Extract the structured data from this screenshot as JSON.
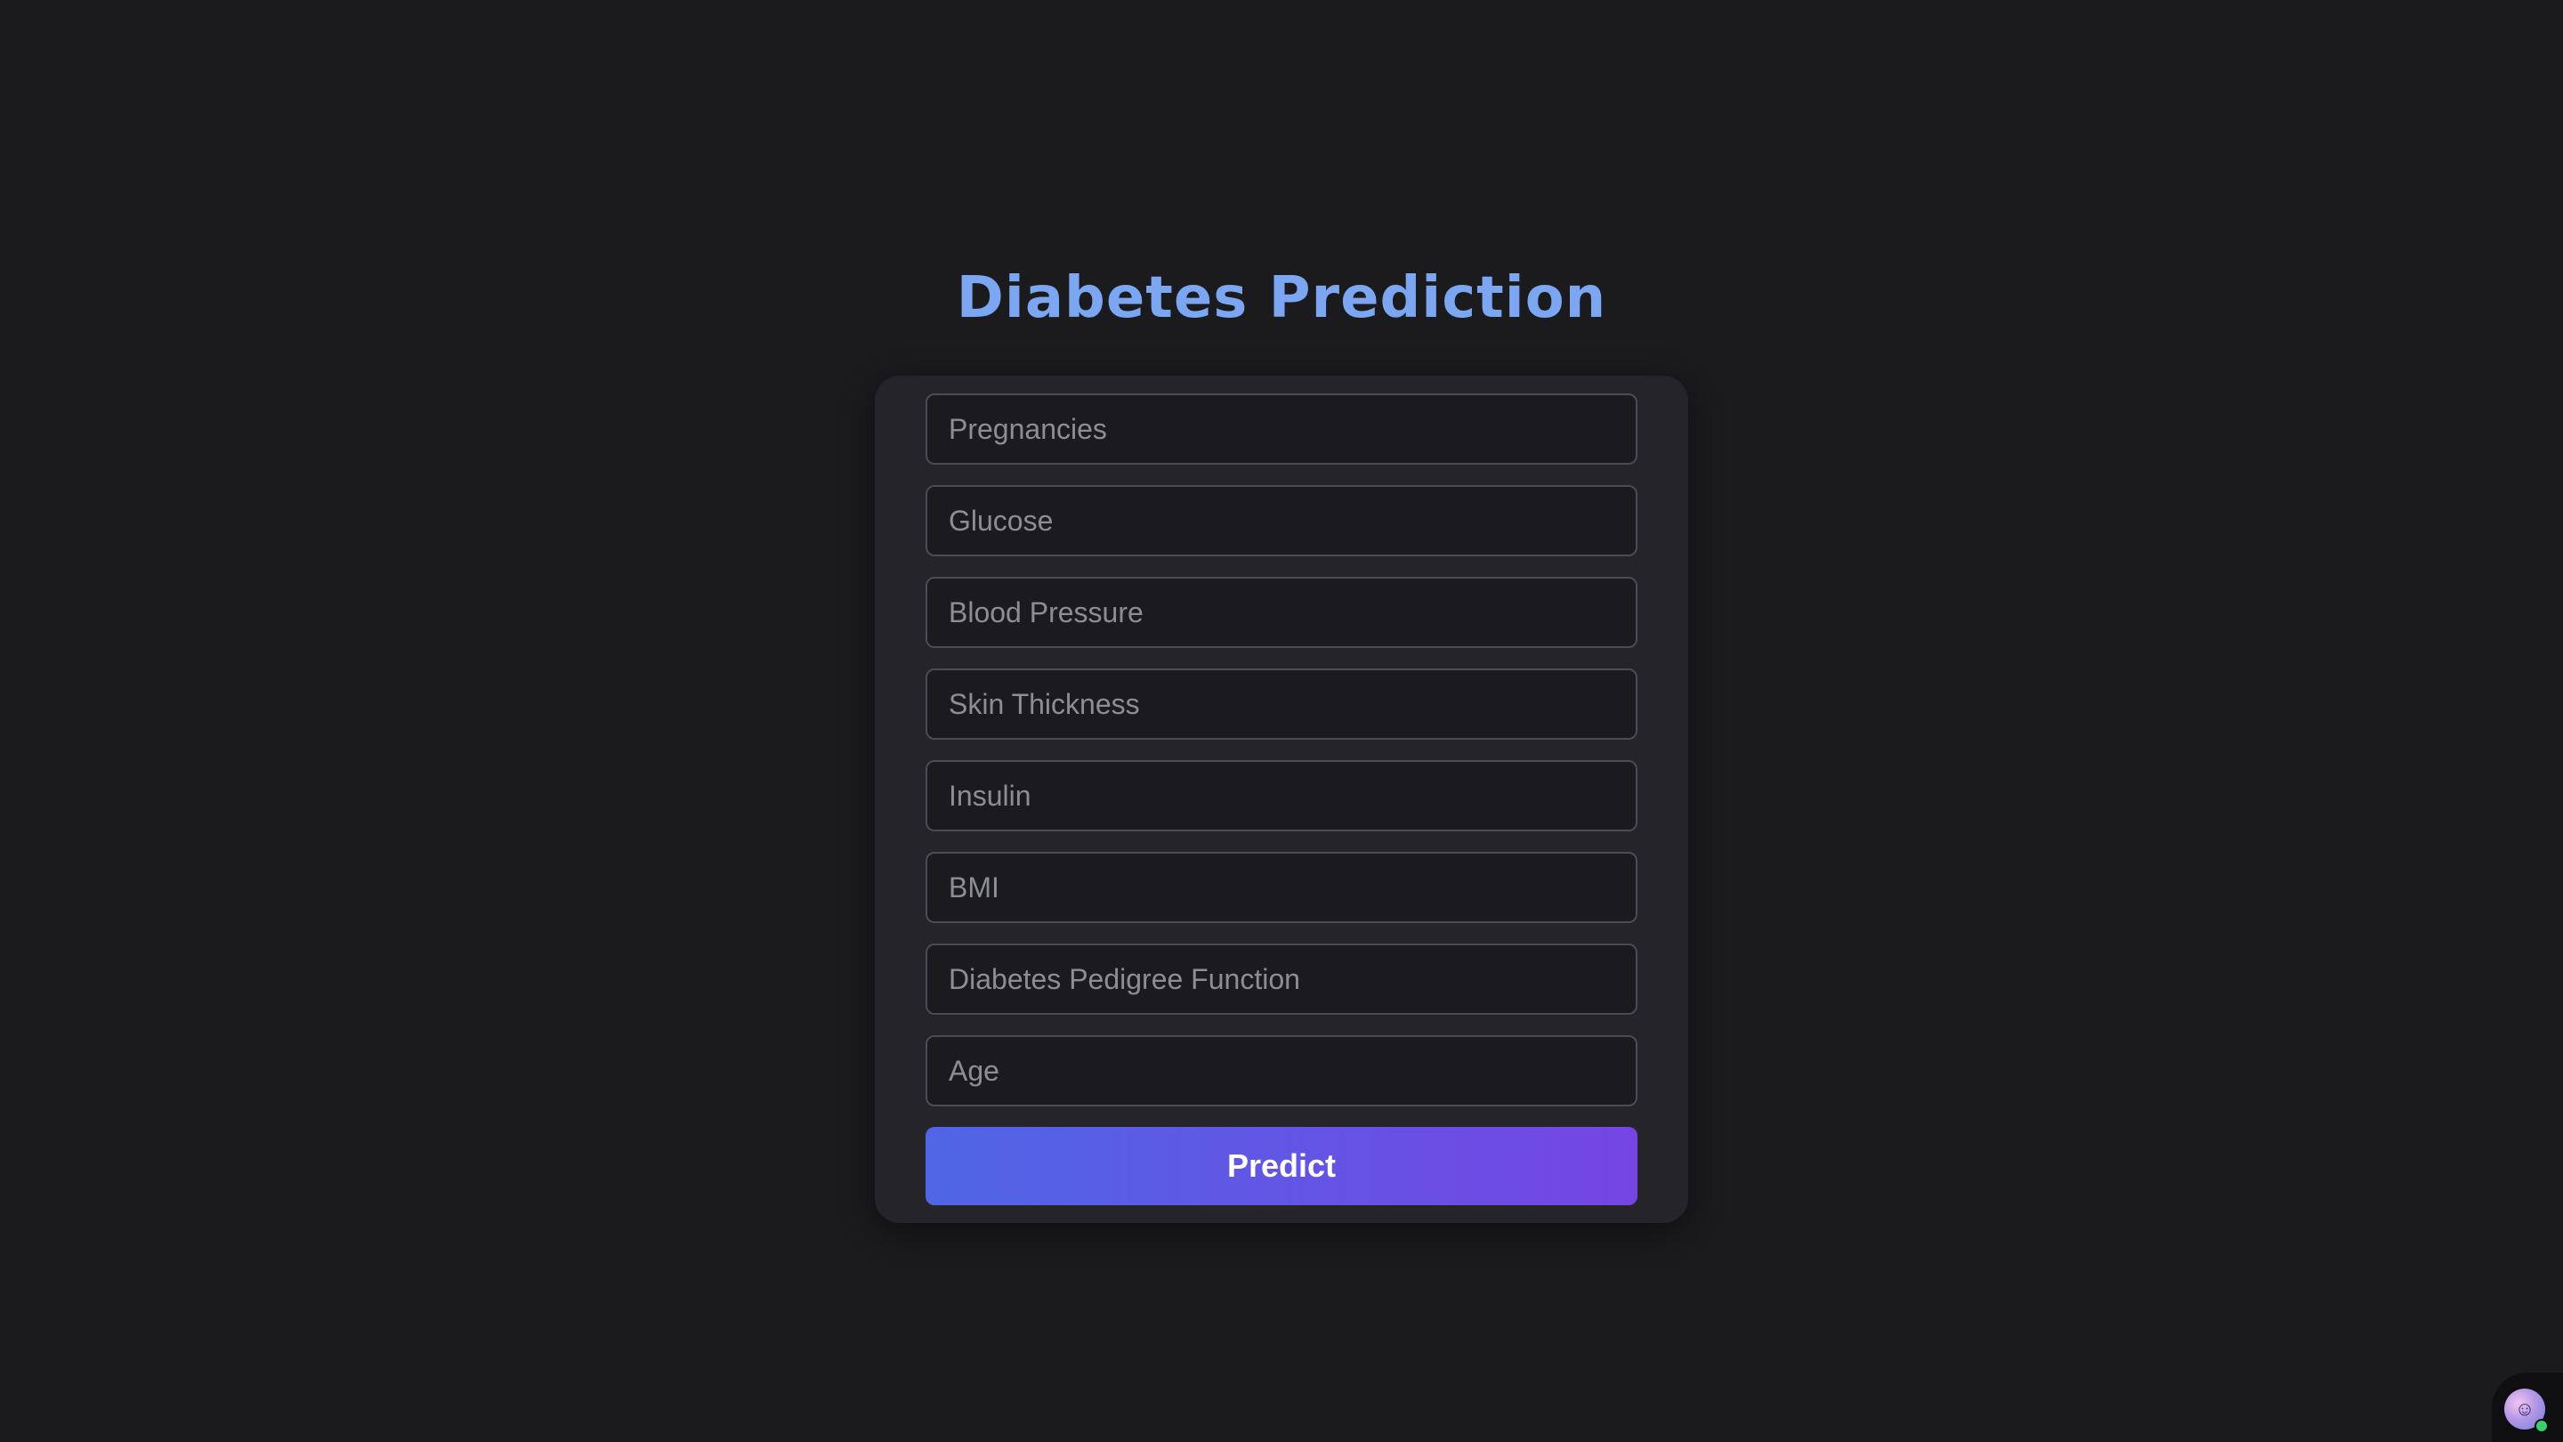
{
  "header": {
    "title": "Diabetes Prediction"
  },
  "form": {
    "fields": [
      {
        "name": "pregnancies-input",
        "placeholder": "Pregnancies",
        "value": ""
      },
      {
        "name": "glucose-input",
        "placeholder": "Glucose",
        "value": ""
      },
      {
        "name": "blood-pressure-input",
        "placeholder": "Blood Pressure",
        "value": ""
      },
      {
        "name": "skin-thickness-input",
        "placeholder": "Skin Thickness",
        "value": ""
      },
      {
        "name": "insulin-input",
        "placeholder": "Insulin",
        "value": ""
      },
      {
        "name": "bmi-input",
        "placeholder": "BMI",
        "value": ""
      },
      {
        "name": "diabetes-pedigree-function-input",
        "placeholder": "Diabetes Pedigree Function",
        "value": ""
      },
      {
        "name": "age-input",
        "placeholder": "Age",
        "value": ""
      }
    ],
    "submit_label": "Predict"
  },
  "assistant": {
    "icon": "assistant-avatar-icon",
    "status": "online"
  },
  "colors": {
    "background": "#1b1b1e",
    "card": "#242429",
    "title": "#7aa6f2",
    "button_gradient_start": "#4f66e6",
    "button_gradient_end": "#7545e4",
    "status_online": "#3ccf6e"
  }
}
